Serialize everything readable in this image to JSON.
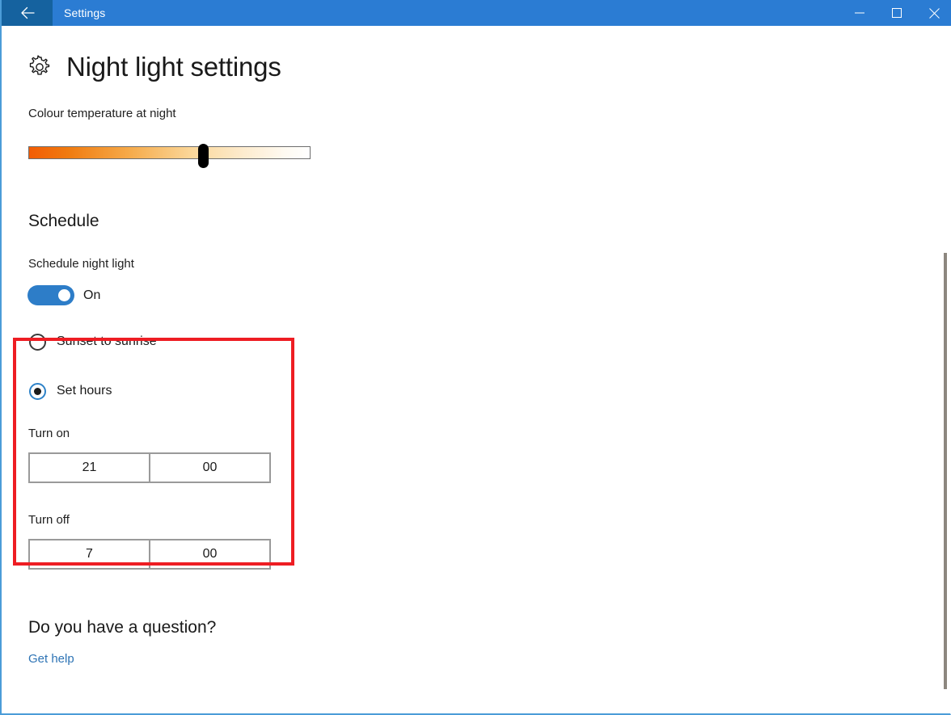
{
  "window": {
    "titlebar": {
      "back_icon": "back-arrow-icon",
      "title": "Settings",
      "minimize_icon": "minimize-icon",
      "maximize_icon": "maximize-icon",
      "close_icon": "close-icon",
      "background_color": "#2b7cd3",
      "back_button_color": "#15629f"
    },
    "border_color": "#4b9cd8"
  },
  "page": {
    "icon": "gear-icon",
    "title": "Night light settings"
  },
  "colour_temperature": {
    "label": "Colour temperature at night",
    "slider": {
      "name": "colour-temperature-slider",
      "thumb_position_percent": 61,
      "gradient_from": "#f25c05",
      "gradient_to": "#ffffff"
    }
  },
  "schedule": {
    "heading": "Schedule",
    "toggle": {
      "label": "Schedule night light",
      "state": "On",
      "on": true,
      "accent_color": "#2d7dc8"
    },
    "options": [
      {
        "label": "Sunset to sunrise",
        "selected": false
      },
      {
        "label": "Set hours",
        "selected": true
      }
    ],
    "set_hours": {
      "turn_on": {
        "label": "Turn on",
        "hour": "21",
        "minute": "00"
      },
      "turn_off": {
        "label": "Turn off",
        "hour": "7",
        "minute": "00"
      }
    }
  },
  "annotation": {
    "name": "red-highlight-box",
    "color": "#ee1d23"
  },
  "help": {
    "heading": "Do you have a question?",
    "link_label": "Get help",
    "link_color": "#2e74b5"
  },
  "scrollbar": {
    "name": "vertical-scrollbar",
    "thumb_color": "#8d877f"
  }
}
